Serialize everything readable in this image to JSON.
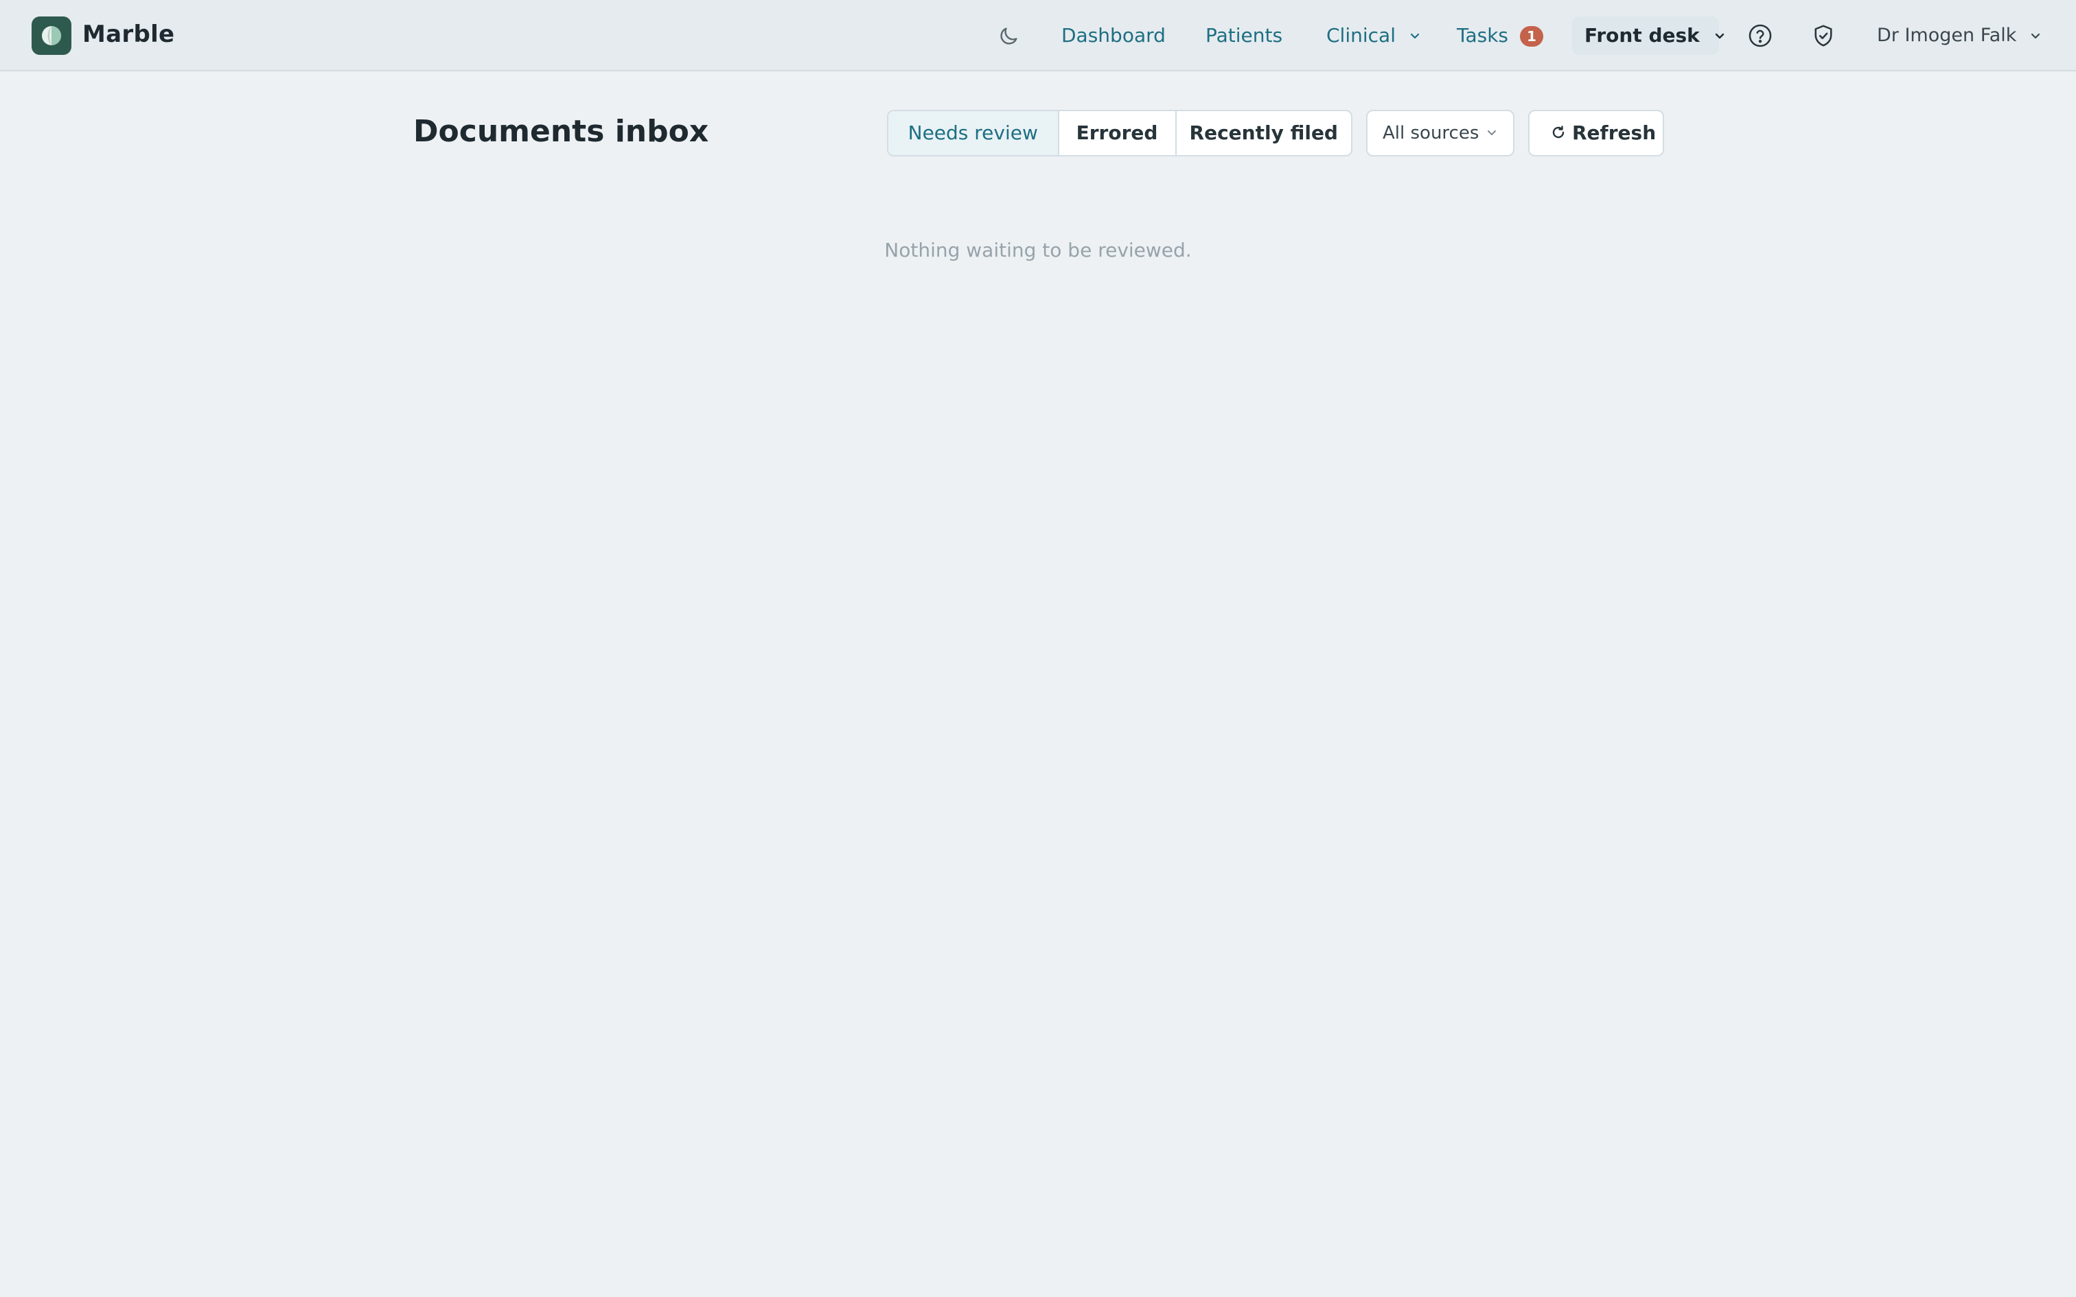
{
  "app": {
    "brand": "Marble",
    "logo_icon": "marble-logo-icon",
    "accent_color": "#1d6f82",
    "badge_color": "#c4624b"
  },
  "nav": {
    "theme_icon": "moon-icon",
    "items": [
      {
        "label": "Dashboard"
      },
      {
        "label": "Patients"
      },
      {
        "label": "Clinical",
        "has_dropdown": true
      },
      {
        "label": "Tasks",
        "badge": "1"
      }
    ],
    "role": {
      "label": "Front desk",
      "has_dropdown": true
    },
    "help_icon": "help-circle-icon",
    "security_icon": "shield-check-icon",
    "user": {
      "label": "Dr Imogen Falk",
      "has_dropdown": true
    }
  },
  "page": {
    "title": "Documents inbox",
    "filters": [
      {
        "label": "Needs review",
        "active": true
      },
      {
        "label": "Errored",
        "active": false
      },
      {
        "label": "Recently filed",
        "active": false
      }
    ],
    "source_select": {
      "value": "All sources"
    },
    "refresh": {
      "label": "Refresh",
      "icon": "refresh-icon"
    },
    "empty_message": "Nothing waiting to be reviewed."
  }
}
